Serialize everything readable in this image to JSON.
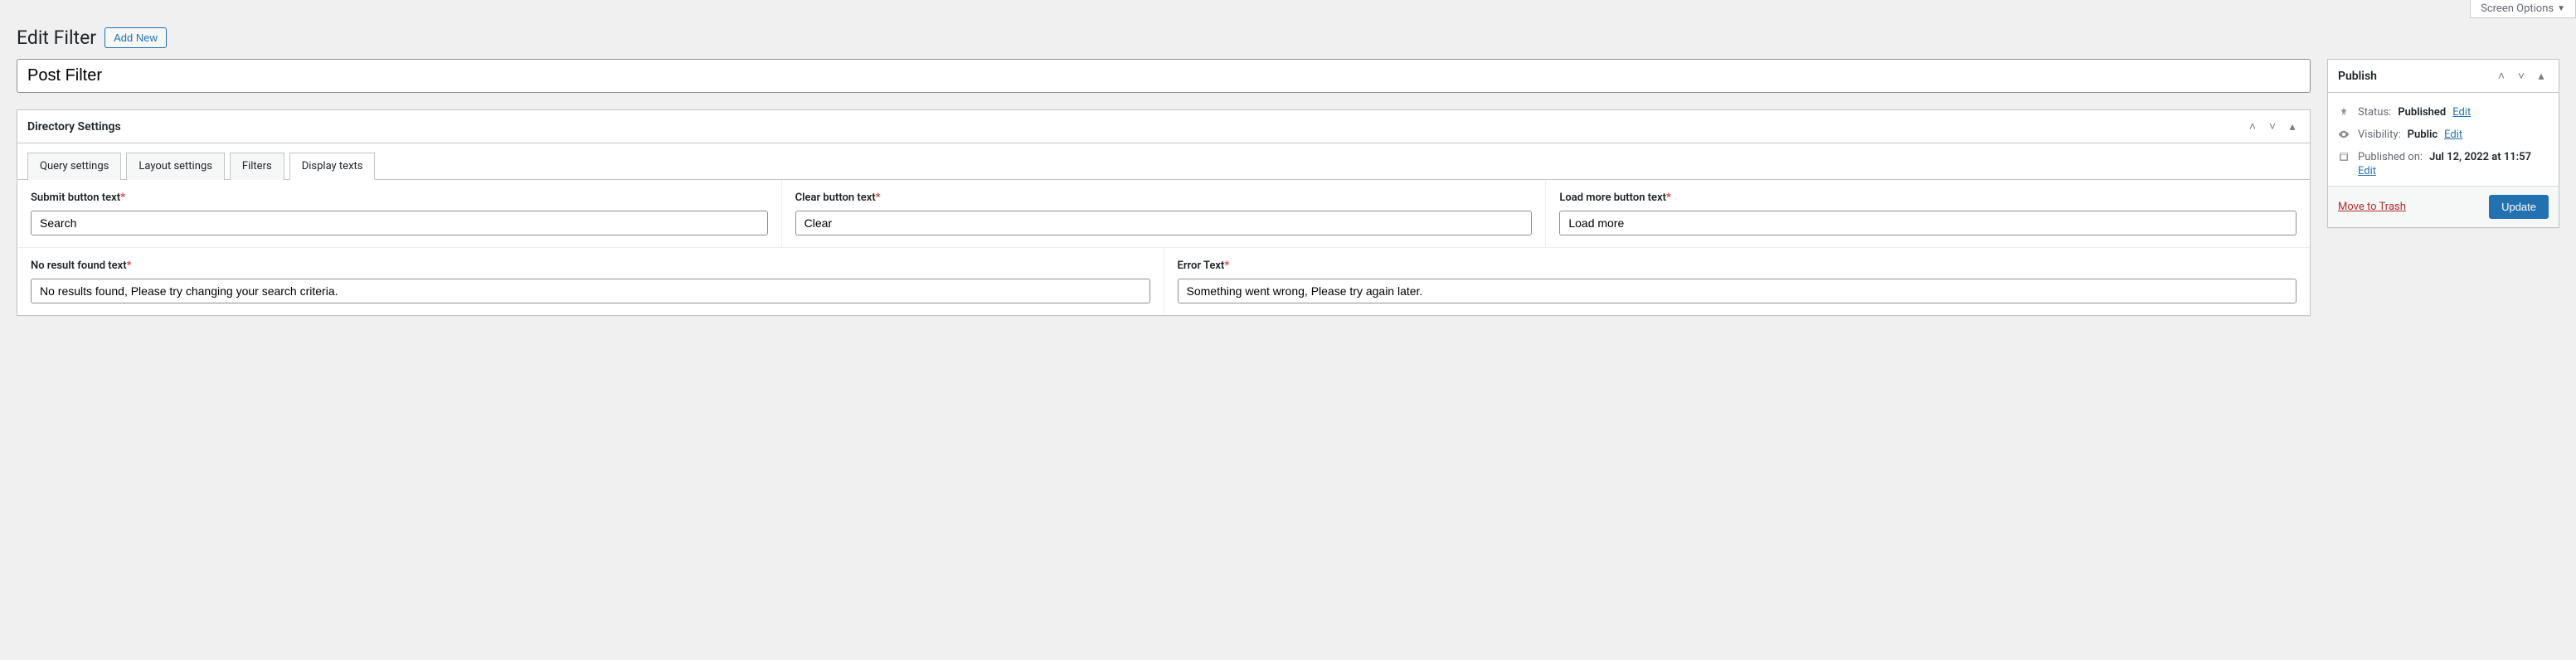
{
  "screenOptions": "Screen Options",
  "header": {
    "title": "Edit Filter",
    "addNew": "Add New"
  },
  "postTitle": "Post Filter",
  "directoryBox": {
    "title": "Directory Settings",
    "tabs": [
      "Query settings",
      "Layout settings",
      "Filters",
      "Display texts"
    ],
    "activeTab": 3,
    "fields": {
      "submitLabel": "Submit button text",
      "submitValue": "Search",
      "clearLabel": "Clear button text",
      "clearValue": "Clear",
      "loadMoreLabel": "Load more button text",
      "loadMoreValue": "Load more",
      "noResultLabel": "No result found text",
      "noResultValue": "No results found, Please try changing your search criteria.",
      "errorLabel": "Error Text",
      "errorValue": "Something went wrong, Please try again later."
    }
  },
  "publish": {
    "title": "Publish",
    "statusLabel": "Status:",
    "statusValue": "Published",
    "visibilityLabel": "Visibility:",
    "visibilityValue": "Public",
    "publishedOnLabel": "Published on:",
    "publishedOnValue": "Jul 12, 2022 at 11:57",
    "editLink": "Edit",
    "trash": "Move to Trash",
    "updateBtn": "Update"
  }
}
